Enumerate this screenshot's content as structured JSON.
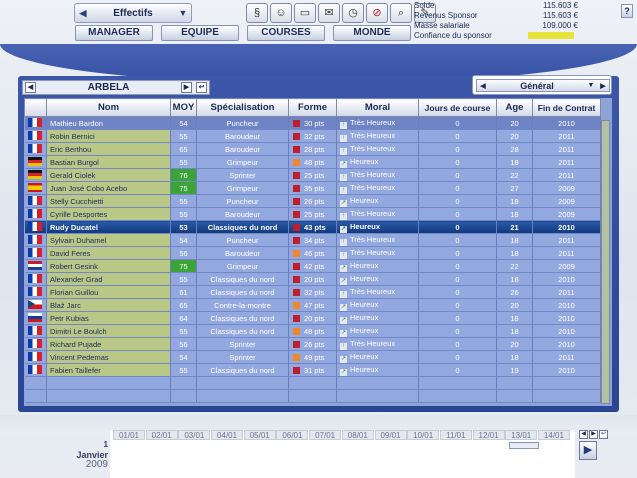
{
  "header": {
    "dropdown_label": "Effectifs",
    "nav": [
      "MANAGER",
      "EQUIPE",
      "COURSES",
      "MONDE"
    ],
    "icons": [
      "document-icon",
      "user-icon",
      "banknote-icon",
      "mail-icon",
      "stopwatch-icon",
      "no-sign-icon",
      "magnifier-icon",
      "pen-icon"
    ],
    "help_label": "?"
  },
  "finance": {
    "rows": [
      {
        "label": "Solde",
        "value": "115.603 €"
      },
      {
        "label": "Revenus Sponsor",
        "value": "115.603 €"
      },
      {
        "label": "Masse salariale",
        "value": "109.000 €"
      },
      {
        "label": "Confiance du sponsor",
        "value": ""
      }
    ],
    "confidence_color": "#e6e43a",
    "confidence_level": 1.0
  },
  "team": {
    "name": "ARBELA"
  },
  "view_select": {
    "value": "Général"
  },
  "table": {
    "columns": [
      "Nom",
      "MOY",
      "Spécialisation",
      "Forme",
      "Moral",
      "Jours de course",
      "Age",
      "Fin de Contrat"
    ],
    "rows": [
      {
        "flag": "fr",
        "name": "Mathieu Bardon",
        "moy": "54",
        "spec": "Puncheur",
        "forme": "30 pts",
        "forme_color": "#c01d2e",
        "moral": "Très Heureux",
        "jours": "0",
        "age": "20",
        "fin": "2010",
        "style": "dark"
      },
      {
        "flag": "fr",
        "name": "Robin Bernici",
        "moy": "55",
        "spec": "Baroudeur",
        "forme": "32 pts",
        "forme_color": "#c01d2e",
        "moral": "Très Heureux",
        "jours": "0",
        "age": "20",
        "fin": "2011",
        "style": "r"
      },
      {
        "flag": "fr",
        "name": "Eric Berthou",
        "moy": "65",
        "spec": "Baroudeur",
        "forme": "28 pts",
        "forme_color": "#c01d2e",
        "moral": "Très Heureux",
        "jours": "0",
        "age": "28",
        "fin": "2011",
        "style": "r"
      },
      {
        "flag": "de",
        "name": "Bastian Burgol",
        "moy": "55",
        "spec": "Grimpeur",
        "forme": "48 pts",
        "forme_color": "#f0882a",
        "moral": "Heureux",
        "jours": "0",
        "age": "18",
        "fin": "2011",
        "style": "r"
      },
      {
        "flag": "de",
        "name": "Gerald Ciolek",
        "moy": "76",
        "spec": "Sprinter",
        "forme": "25 pts",
        "forme_color": "#c01d2e",
        "moral": "Très Heureux",
        "jours": "0",
        "age": "22",
        "fin": "2011",
        "style": "r",
        "moy_green": true
      },
      {
        "flag": "es",
        "name": "Juan José Cobo Acebo",
        "moy": "75",
        "spec": "Grimpeur",
        "forme": "35 pts",
        "forme_color": "#c01d2e",
        "moral": "Très Heureux",
        "jours": "0",
        "age": "27",
        "fin": "2009",
        "style": "r",
        "moy_green": true
      },
      {
        "flag": "fr",
        "name": "Stelly Cucchietti",
        "moy": "55",
        "spec": "Puncheur",
        "forme": "26 pts",
        "forme_color": "#c01d2e",
        "moral": "Heureux",
        "jours": "0",
        "age": "18",
        "fin": "2009",
        "style": "r"
      },
      {
        "flag": "fr",
        "name": "Cyrille Desportes",
        "moy": "55",
        "spec": "Baroudeur",
        "forme": "25 pts",
        "forme_color": "#c01d2e",
        "moral": "Très Heureux",
        "jours": "0",
        "age": "18",
        "fin": "2009",
        "style": "r"
      },
      {
        "flag": "fr",
        "name": "Rudy Ducatel",
        "moy": "53",
        "spec": "Classiques du nord",
        "forme": "43 pts",
        "forme_color": "#c01d2e",
        "moral": "Heureux",
        "jours": "0",
        "age": "21",
        "fin": "2010",
        "style": "sel"
      },
      {
        "flag": "fr",
        "name": "Sylvain Duhamel",
        "moy": "54",
        "spec": "Puncheur",
        "forme": "34 pts",
        "forme_color": "#c01d2e",
        "moral": "Très Heureux",
        "jours": "0",
        "age": "18",
        "fin": "2011",
        "style": "r"
      },
      {
        "flag": "fr",
        "name": "David Feres",
        "moy": "56",
        "spec": "Baroudeur",
        "forme": "46 pts",
        "forme_color": "#f0882a",
        "moral": "Très Heureux",
        "jours": "0",
        "age": "18",
        "fin": "2011",
        "style": "r"
      },
      {
        "flag": "nl",
        "name": "Robert Gesink",
        "moy": "75",
        "spec": "Grimpeur",
        "forme": "42 pts",
        "forme_color": "#c01d2e",
        "moral": "Heureux",
        "jours": "0",
        "age": "22",
        "fin": "2009",
        "style": "r",
        "moy_green": true
      },
      {
        "flag": "fr",
        "name": "Alexander Grad",
        "moy": "55",
        "spec": "Classiques du nord",
        "forme": "20 pts",
        "forme_color": "#c01d2e",
        "moral": "Heureux",
        "jours": "0",
        "age": "18",
        "fin": "2010",
        "style": "r"
      },
      {
        "flag": "fr",
        "name": "Florian Guillou",
        "moy": "61",
        "spec": "Classiques du nord",
        "forme": "32 pts",
        "forme_color": "#c01d2e",
        "moral": "Très Heureux",
        "jours": "0",
        "age": "26",
        "fin": "2011",
        "style": "r"
      },
      {
        "flag": "cz",
        "name": "Blaž Jarc",
        "moy": "65",
        "spec": "Contre-la-montre",
        "forme": "47 pts",
        "forme_color": "#f0882a",
        "moral": "Heureux",
        "jours": "0",
        "age": "20",
        "fin": "2010",
        "style": "r"
      },
      {
        "flag": "si",
        "name": "Petr Kubias",
        "moy": "64",
        "spec": "Classiques du nord",
        "forme": "20 pts",
        "forme_color": "#c01d2e",
        "moral": "Heureux",
        "jours": "0",
        "age": "18",
        "fin": "2010",
        "style": "r"
      },
      {
        "flag": "fr",
        "name": "Dimitri Le Boulch",
        "moy": "55",
        "spec": "Classiques du nord",
        "forme": "48 pts",
        "forme_color": "#f0882a",
        "moral": "Heureux",
        "jours": "0",
        "age": "18",
        "fin": "2010",
        "style": "r"
      },
      {
        "flag": "fr",
        "name": "Richard Pujade",
        "moy": "56",
        "spec": "Sprinter",
        "forme": "26 pts",
        "forme_color": "#c01d2e",
        "moral": "Très Heureux",
        "jours": "0",
        "age": "20",
        "fin": "2010",
        "style": "r"
      },
      {
        "flag": "fr",
        "name": "Vincent Pedemas",
        "moy": "54",
        "spec": "Sprinter",
        "forme": "49 pts",
        "forme_color": "#f0882a",
        "moral": "Heureux",
        "jours": "0",
        "age": "18",
        "fin": "2011",
        "style": "r"
      },
      {
        "flag": "fr",
        "name": "Fabien Taillefer",
        "moy": "55",
        "spec": "Classiques du nord",
        "forme": "31 pts",
        "forme_color": "#c01d2e",
        "moral": "Heureux",
        "jours": "0",
        "age": "19",
        "fin": "2010",
        "style": "r"
      }
    ],
    "empty_rows": 2
  },
  "calendar": {
    "day": "1",
    "month": "Janvier",
    "year": "2009",
    "days": [
      "01/01",
      "02/01",
      "03/01",
      "04/01",
      "05/01",
      "06/01",
      "07/01",
      "08/01",
      "09/01",
      "10/01",
      "11/01",
      "12/01",
      "13/01",
      "14/01"
    ]
  }
}
